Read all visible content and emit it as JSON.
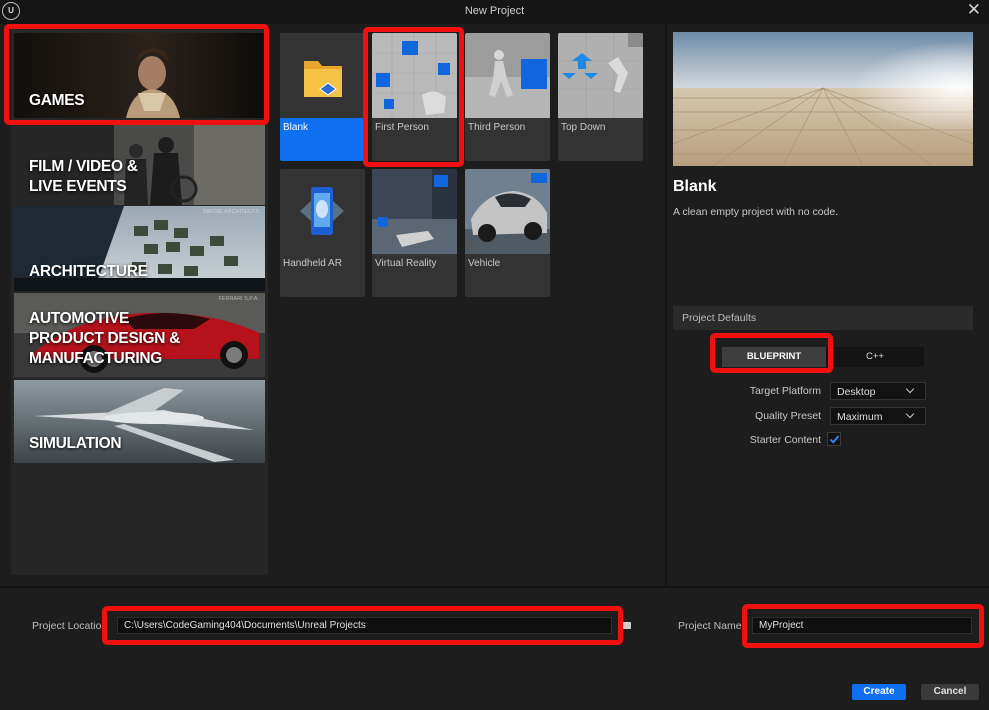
{
  "window": {
    "title": "New Project",
    "close_icon": "close-icon"
  },
  "categories": [
    {
      "label": "GAMES"
    },
    {
      "label": "FILM / VIDEO &\nLIVE EVENTS"
    },
    {
      "label": "ARCHITECTURE",
      "watermark": "SAFDIE ARCHITECTS"
    },
    {
      "label": "AUTOMOTIVE\nPRODUCT DESIGN &\nMANUFACTURING",
      "watermark": "FERRARI S.P.A."
    },
    {
      "label": "SIMULATION"
    }
  ],
  "templates": [
    {
      "label": "Blank",
      "selected": true
    },
    {
      "label": "First Person"
    },
    {
      "label": "Third Person"
    },
    {
      "label": "Top Down"
    },
    {
      "label": "Handheld AR"
    },
    {
      "label": "Virtual Reality"
    },
    {
      "label": "Vehicle"
    }
  ],
  "details": {
    "title": "Blank",
    "description": "A clean empty project with no code."
  },
  "project_defaults": {
    "header": "Project Defaults",
    "blueprint_label": "BLUEPRINT",
    "cpp_label": "C++",
    "target_platform_label": "Target Platform",
    "target_platform_value": "Desktop",
    "quality_preset_label": "Quality Preset",
    "quality_preset_value": "Maximum",
    "starter_content_label": "Starter Content",
    "starter_content_checked": true
  },
  "footer": {
    "location_label": "Project Location",
    "location_value": "C:\\Users\\CodeGaming404\\Documents\\Unreal Projects",
    "name_label": "Project Name",
    "name_value": "MyProject",
    "create_label": "Create",
    "cancel_label": "Cancel"
  },
  "colors": {
    "accent": "#0e6ff0",
    "highlight": "#f01010",
    "background": "#1d1d1d"
  }
}
